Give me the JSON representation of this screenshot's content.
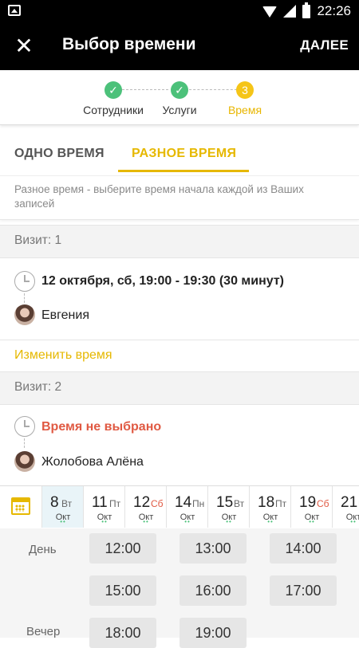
{
  "status_bar": {
    "time": "22:26"
  },
  "app_bar": {
    "title": "Выбор времени",
    "next_label": "ДАЛЕЕ",
    "close_glyph": "✕"
  },
  "stepper": [
    {
      "label": "Сотрудники",
      "state": "done",
      "mark": "✓"
    },
    {
      "label": "Услуги",
      "state": "done",
      "mark": "✓"
    },
    {
      "label": "Время",
      "state": "current",
      "mark": "3"
    }
  ],
  "tabs": [
    {
      "label": "ОДНО ВРЕМЯ",
      "active": false
    },
    {
      "label": "РАЗНОЕ ВРЕМЯ",
      "active": true
    }
  ],
  "info_text": "Разное время - выберите время начала каждой из Ваших записей",
  "visit1": {
    "header": "Визит: 1",
    "time": "12 октября, сб, 19:00 - 19:30 (30 минут)",
    "staff": "Евгения",
    "change_link": "Изменить время"
  },
  "visit2": {
    "header": "Визит: 2",
    "time": "Время не выбрано",
    "staff": "Жолобова Алёна"
  },
  "calendar": {
    "days": [
      {
        "num": "8",
        "wd": "Вт",
        "mon": "Окт",
        "weekend": false,
        "selected": true
      },
      {
        "num": "11",
        "wd": "Пт",
        "mon": "Окт",
        "weekend": false,
        "selected": false
      },
      {
        "num": "12",
        "wd": "Сб",
        "mon": "Окт",
        "weekend": true,
        "selected": false
      },
      {
        "num": "14",
        "wd": "Пн",
        "mon": "Окт",
        "weekend": false,
        "selected": false
      },
      {
        "num": "15",
        "wd": "Вт",
        "mon": "Окт",
        "weekend": false,
        "selected": false
      },
      {
        "num": "18",
        "wd": "Пт",
        "mon": "Окт",
        "weekend": false,
        "selected": false
      },
      {
        "num": "19",
        "wd": "Сб",
        "mon": "Окт",
        "weekend": true,
        "selected": false
      },
      {
        "num": "21",
        "wd": "Пн",
        "mon": "Окт",
        "weekend": false,
        "selected": false
      }
    ]
  },
  "slots": {
    "day_label": "День",
    "evening_label": "Вечер",
    "day_times": [
      "12:00",
      "13:00",
      "14:00",
      "15:00",
      "16:00",
      "17:00"
    ],
    "evening_times": [
      "18:00",
      "19:00"
    ]
  },
  "colors": {
    "accent": "#e6b800",
    "done": "#4cc17a",
    "error": "#e05a43",
    "bar": "#000000"
  }
}
